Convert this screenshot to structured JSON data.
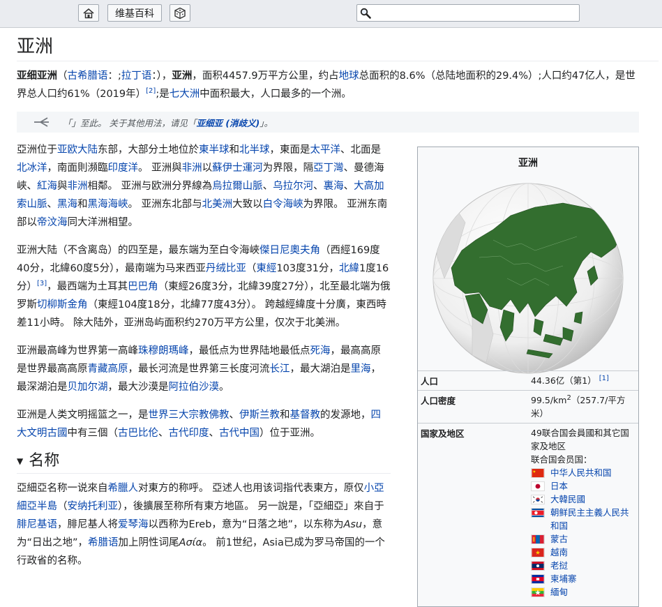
{
  "topbar": {
    "home_icon": "home-icon",
    "wiki_label": "维基百科",
    "random_icon": "dice-icon",
    "search_icon": "magnifier-icon",
    "search_value": ""
  },
  "page_title": "亚洲",
  "lead": {
    "p1": "亚细亚洲",
    "p2": "（",
    "greek_link": "古希腊语",
    "p3": "：;",
    "latin_link": "拉丁语",
    "p4": "：），",
    "bold2": "亚洲",
    "p5": "，面积4457.9万平方公里，约占",
    "earth_link": "地球",
    "p6": "总面积的8.6%（总陆地面积的29.4%）;人口约47亿人，是世界总人口约61%（2019年）",
    "ref": "[2]",
    "p7": ";是",
    "continents_link": "七大洲",
    "p8": "中面积最大，人口最多的一个洲。"
  },
  "hatnote": {
    "icon": "disambiguation-icon",
    "text": "「」至此。 关于其他用法，请见「",
    "link": "亚细亚 (消歧义)",
    "end": "」。"
  },
  "para1": {
    "a": "亞洲位于",
    "l1": "亚欧大陆",
    "b": "东部，大部分土地位於",
    "l2": "東半球",
    "c": "和",
    "l3": "北半球",
    "d": "，東面是",
    "l4": "太平洋",
    "e": "、北面是",
    "l5": "北冰洋",
    "f": "，南面則瀕臨",
    "l6": "印度洋",
    "g": "。 亚洲與",
    "l7": "非洲",
    "h": "以",
    "l8": "蘇伊士運河",
    "i": "为界限，隔",
    "l9": "亞丁灣",
    "j": "、曼德海峽、",
    "l10": "紅海",
    "k": "與",
    "l11": "非洲",
    "l": "相鄰。 亚洲与欧洲分界線為",
    "l12": "烏拉爾山脈",
    "m": "、",
    "l13": "乌拉尔河",
    "n": "、",
    "l14": "裏海",
    "o": "、",
    "l15": "大高加索山脈",
    "p": "、",
    "l16": "黑海",
    "q": "和",
    "l17": "黑海海峽",
    "r": "。 亚洲东北部与",
    "l18": "北美洲",
    "s": "大致以",
    "l19": "白令海峽",
    "t": "为界限。 亚洲东南部以",
    "l20": "帝汶海",
    "u": "同大洋洲相望。"
  },
  "para2": {
    "a": "亚洲大陆（不含离岛）的四至是，最东端为至白令海峽",
    "l1": "傑日尼奧夫角",
    "b": "（西經169度40分，北緯60度5分），最南端为马来西亚",
    "l2": "丹绒比亚",
    "c": "（",
    "l3": "東經",
    "d": "103度31分，",
    "l4": "北緯",
    "e": "1度16分）",
    "ref": "[3]",
    "f": "，最西端为土耳其",
    "l5": "巴巴角",
    "g": "（東經26度3分，北緯39度27分），北至最北端为俄罗斯",
    "l6": "切柳斯金角",
    "h": "（東經104度18分，北緯77度43分）。 跨越經緯度十分廣，東西時差11小時。 除大陆外，亚洲岛屿面积约270万平方公里，仅次于北美洲。"
  },
  "para3": {
    "a": "亚洲最高峰为世界第一高峰",
    "l1": "珠穆朗瑪峰",
    "b": "，最低点为世界陆地最低点",
    "l2": "死海",
    "c": "，最高高原是世界最高高原",
    "l3": "青藏高原",
    "d": "，最长河流是世界第三长度河流",
    "l4": "长江",
    "e": "，最大湖泊是",
    "l5": "里海",
    "f": "，最深湖泊是",
    "l6": "贝加尔湖",
    "g": "，最大沙漠是",
    "l7": "阿拉伯沙漠",
    "h": "。"
  },
  "para4": {
    "a": "亚洲是人类文明摇篮之一，是",
    "l1": "世界三大宗教",
    "l2": "佛教",
    "b": "、",
    "l3": "伊斯兰教",
    "c": "和",
    "l4": "基督教",
    "d": "的发源地，",
    "l5": "四大文明古國",
    "e": "中有三個（",
    "l6": "古巴比伦",
    "f": "、",
    "l7": "古代印度",
    "g": "、",
    "l8": "古代中国",
    "h": "）位于亚洲。"
  },
  "section_name": {
    "arrow": "▼",
    "title": "名称"
  },
  "para5": {
    "a": "亞細亞名称一说來自",
    "l1": "希臘人",
    "b": "对東方的称呼。 亞述人也用该词指代表東方，原仅",
    "l2": "小亞細亞半島",
    "c": "（",
    "l3": "安纳托利亚",
    "d": "），後擴展至称所有東方地區。 另一說是，「亞細亞」來自于",
    "l4": "腓尼基语",
    "e": "，腓尼基人将",
    "l5": "爱琴海",
    "f": "以西称为Ereb，意为“日落之地”，以东称为",
    "i1": "Asu",
    "g": "，意为“日出之地”，",
    "l6": "希腊语",
    "h": "加上阴性词尾",
    "i2": "Ασία",
    "j": "。 前1世纪，Asia已成为罗马帝国的一个行政省的名称。"
  },
  "infobox": {
    "title": "亚洲",
    "map_icon": "asia-globe-map",
    "rows": [
      {
        "key": "人口",
        "val": "44.36亿（第1）",
        "ref": "[1]"
      },
      {
        "key": "人口密度",
        "val": "99.5/km",
        "sup": "2",
        "val2": "（257.7/平方米）"
      },
      {
        "key": "国家及地区",
        "val": "49联合国会員國和其它国家及地区",
        "sub": "联合国会员国："
      }
    ],
    "countries": [
      {
        "name": "中华人民共和国",
        "flag": "china-flag"
      },
      {
        "name": "日本",
        "flag": "japan-flag"
      },
      {
        "name": "大韓民國",
        "flag": "korea-flag"
      },
      {
        "name": "朝鲜民主主義人民共和国",
        "flag": "dprk-flag"
      },
      {
        "name": "蒙古",
        "flag": "mongolia-flag"
      },
      {
        "name": "越南",
        "flag": "vietnam-flag"
      },
      {
        "name": "老挝",
        "flag": "laos-flag"
      },
      {
        "name": "柬埔寨",
        "flag": "cambodia-flag"
      },
      {
        "name": "緬甸",
        "flag": "myanmar-flag"
      }
    ]
  }
}
